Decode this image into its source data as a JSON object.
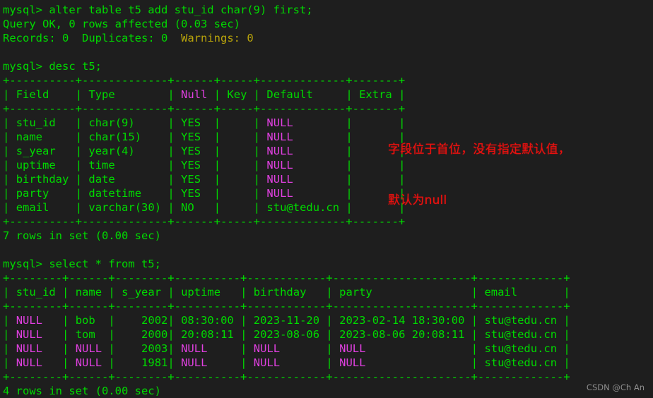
{
  "terminal": {
    "prompt": "mysql> ",
    "colors": {
      "background": "#1e1e1e",
      "green": "#00d900",
      "magenta": "#e040e0",
      "yellow": "#b9a40b",
      "annotation_red": "#e8110f",
      "watermark_gray": "#8e8e8e"
    }
  },
  "session": {
    "command1": "alter table t5 add stu_id char(9) first;",
    "result1_line1": "Query OK, 0 rows affected (0.03 sec)",
    "result1_records": "Records: 0",
    "result1_duplicates": "Duplicates: 0",
    "result1_warnings": "Warnings: 0",
    "command2": "desc t5;",
    "desc_footer": "7 rows in set (0.00 sec)",
    "command3": "select * from t5;",
    "select_footer": "4 rows in set (0.00 sec)"
  },
  "desc_table": {
    "rule_top": "+----------+-------------+------+-----+-------------+-------+",
    "rule_mid": "+----------+-------------+------+-----+-------------+-------+",
    "rule_bottom": "+----------+-------------+------+-----+-------------+-------+",
    "headers": [
      "Field",
      "Type",
      "Null",
      "Key",
      "Default",
      "Extra"
    ],
    "header_cells": [
      {
        "text": "Field",
        "width": 9,
        "color": "green"
      },
      {
        "text": "Type",
        "width": 12,
        "color": "green"
      },
      {
        "text": "Null",
        "width": 5,
        "color": "magenta"
      },
      {
        "text": "Key",
        "width": 4,
        "color": "green"
      },
      {
        "text": "Default",
        "width": 12,
        "color": "green"
      },
      {
        "text": "Extra",
        "width": 6,
        "color": "green"
      }
    ],
    "rows": [
      {
        "field": "stu_id",
        "type": "char(9)",
        "null": "YES",
        "key": "",
        "default": "NULL",
        "default_color": "magenta",
        "extra": ""
      },
      {
        "field": "name",
        "type": "char(15)",
        "null": "YES",
        "key": "",
        "default": "NULL",
        "default_color": "magenta",
        "extra": ""
      },
      {
        "field": "s_year",
        "type": "year(4)",
        "null": "YES",
        "key": "",
        "default": "NULL",
        "default_color": "magenta",
        "extra": ""
      },
      {
        "field": "uptime",
        "type": "time",
        "null": "YES",
        "key": "",
        "default": "NULL",
        "default_color": "magenta",
        "extra": ""
      },
      {
        "field": "birthday",
        "type": "date",
        "null": "YES",
        "key": "",
        "default": "NULL",
        "default_color": "magenta",
        "extra": ""
      },
      {
        "field": "party",
        "type": "datetime",
        "null": "YES",
        "key": "",
        "default": "NULL",
        "default_color": "magenta",
        "extra": ""
      },
      {
        "field": "email",
        "type": "varchar(30)",
        "null": "NO",
        "key": "",
        "default": "stu@tedu.cn",
        "default_color": "green",
        "extra": ""
      }
    ]
  },
  "select_table": {
    "rule": "+--------+------+--------+----------+------------+---------------------+-------------+",
    "headers": [
      "stu_id",
      "name",
      "s_year",
      "uptime",
      "birthday",
      "party",
      "email"
    ],
    "header_cells": [
      {
        "text": "stu_id",
        "width": 7
      },
      {
        "text": "name",
        "width": 5
      },
      {
        "text": "s_year",
        "width": 7
      },
      {
        "text": "uptime",
        "width": 9
      },
      {
        "text": "birthday",
        "width": 11
      },
      {
        "text": "party",
        "width": 20
      },
      {
        "text": "email",
        "width": 12
      }
    ],
    "rows": [
      {
        "stu_id": "NULL",
        "stu_id_color": "magenta",
        "name": "bob",
        "name_color": "green",
        "s_year": "2002",
        "s_year_color": "green",
        "uptime": "08:30:00",
        "uptime_color": "green",
        "birthday": "2023-11-20",
        "birthday_color": "green",
        "party": "2023-02-14 18:30:00",
        "party_color": "green",
        "email": "stu@tedu.cn",
        "email_color": "green"
      },
      {
        "stu_id": "NULL",
        "stu_id_color": "magenta",
        "name": "tom",
        "name_color": "green",
        "s_year": "2000",
        "s_year_color": "green",
        "uptime": "20:08:11",
        "uptime_color": "green",
        "birthday": "2023-08-06",
        "birthday_color": "green",
        "party": "2023-08-06 20:08:11",
        "party_color": "green",
        "email": "stu@tedu.cn",
        "email_color": "green"
      },
      {
        "stu_id": "NULL",
        "stu_id_color": "magenta",
        "name": "NULL",
        "name_color": "magenta",
        "s_year": "2003",
        "s_year_color": "green",
        "uptime": "NULL",
        "uptime_color": "magenta",
        "birthday": "NULL",
        "birthday_color": "magenta",
        "party": "NULL",
        "party_color": "magenta",
        "email": "stu@tedu.cn",
        "email_color": "green"
      },
      {
        "stu_id": "NULL",
        "stu_id_color": "magenta",
        "name": "NULL",
        "name_color": "magenta",
        "s_year": "1981",
        "s_year_color": "green",
        "uptime": "NULL",
        "uptime_color": "magenta",
        "birthday": "NULL",
        "birthday_color": "magenta",
        "party": "NULL",
        "party_color": "magenta",
        "email": "stu@tedu.cn",
        "email_color": "green"
      }
    ]
  },
  "annotation": {
    "line1": "字段位于首位，没有指定默认值，",
    "line2": "默认为null"
  },
  "watermark": {
    "text": "CSDN @Ch An"
  }
}
